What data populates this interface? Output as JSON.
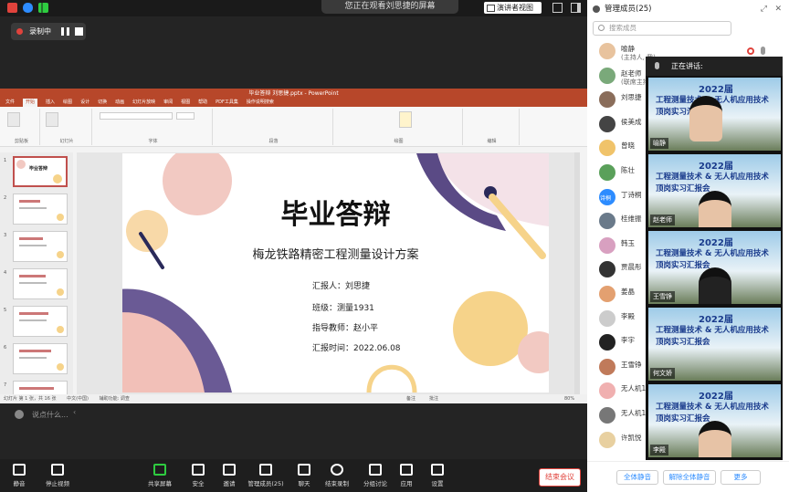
{
  "share_banner": "您正在观看刘思捷的屏幕",
  "view_menu": "演讲者视图",
  "recording": {
    "label": "录制中"
  },
  "ppt": {
    "title": "毕业答辩 刘思捷.pptx  -  PowerPoint",
    "tabs": [
      "文件",
      "开始",
      "插入",
      "绘图",
      "设计",
      "切换",
      "动画",
      "幻灯片放映",
      "审阅",
      "视图",
      "帮助",
      "PDF工具集",
      "操作说明搜索"
    ],
    "groups": [
      "剪贴板",
      "幻灯片",
      "字体",
      "段落",
      "绘图",
      "编辑"
    ],
    "status_left": "幻灯片 第 1 张，共 16 张",
    "status_lang": "中文(中国)",
    "status_access": "辅助功能: 调查",
    "status_notes": "备注",
    "status_comments": "批注",
    "status_zoom": "80%"
  },
  "slide": {
    "title": "毕业答辩",
    "subtitle": "梅龙铁路精密工程测量设计方案",
    "reporter": "汇报人：刘思捷",
    "class": "班级：测量1931",
    "teacher": "指导教师：赵小平",
    "date": "汇报时间：2022.06.08"
  },
  "thumb_numbers": [
    "1",
    "2",
    "3",
    "4",
    "5",
    "6",
    "7"
  ],
  "thumb_title": "毕业答辩",
  "chat_placeholder": "说点什么...",
  "toolbar": [
    {
      "label": "静音",
      "icon": "mic-icon"
    },
    {
      "label": "停止视频",
      "icon": "video-icon"
    },
    {
      "label": "共享屏幕",
      "icon": "share-screen-icon"
    },
    {
      "label": "安全",
      "icon": "shield-icon"
    },
    {
      "label": "邀请",
      "icon": "invite-icon"
    },
    {
      "label": "管理成员(25)",
      "icon": "participants-icon"
    },
    {
      "label": "聊天",
      "icon": "chat-icon"
    },
    {
      "label": "结束录制",
      "icon": "record-icon"
    },
    {
      "label": "分组讨论",
      "icon": "breakout-icon"
    },
    {
      "label": "应用",
      "icon": "apps-icon"
    },
    {
      "label": "设置",
      "icon": "gear-icon"
    }
  ],
  "end_meeting": "结束会议",
  "panel": {
    "title": "管理成员(25)",
    "search_placeholder": "搜索成员",
    "speaking": "正在讲话:",
    "members": [
      {
        "name": "喻静",
        "sub": "(主持人, 我)",
        "color": "#e8c39e"
      },
      {
        "name": "赵老师",
        "sub": "(联席主持人)",
        "color": "#7aa97a"
      },
      {
        "name": "刘思捷",
        "sub": "",
        "color": "#8a6d5a"
      },
      {
        "name": "侯美成",
        "sub": "",
        "color": "#444444"
      },
      {
        "name": "曾晓",
        "sub": "",
        "color": "#f0c36a"
      },
      {
        "name": "陈壮",
        "sub": "",
        "color": "#5aa05a"
      },
      {
        "name": "丁诗桐",
        "sub": "",
        "color": "#2d8cff"
      },
      {
        "name": "桂维振",
        "sub": "",
        "color": "#6a7a8a"
      },
      {
        "name": "韩玉",
        "sub": "",
        "color": "#d8a0c0"
      },
      {
        "name": "贾晨彤",
        "sub": "",
        "color": "#333333"
      },
      {
        "name": "姜晶",
        "sub": "",
        "color": "#e3a070"
      },
      {
        "name": "李殿",
        "sub": "",
        "color": "#cccccc"
      },
      {
        "name": "李宇",
        "sub": "",
        "color": "#222222"
      },
      {
        "name": "王雪铮",
        "sub": "",
        "color": "#c07a5a"
      },
      {
        "name": "无人机1组",
        "sub": "",
        "color": "#f0b0b0"
      },
      {
        "name": "无人机1组",
        "sub": "",
        "color": "#777777"
      },
      {
        "name": "许凯悦",
        "sub": "",
        "color": "#e8d0a0"
      }
    ],
    "avatar_text_dingshitong": "诗桐",
    "btn_mute_all": "全体静音",
    "btn_unmute_all": "解除全体静音",
    "btn_more": "更多"
  },
  "videos": [
    {
      "name": "喻静",
      "title": "2022届"
    },
    {
      "name": "赵老师",
      "title": "2022届"
    },
    {
      "name": "王雪铮",
      "title": "2022届"
    },
    {
      "name": "何文娇",
      "title": "2022届"
    },
    {
      "name": "李殿",
      "title": "2022届"
    }
  ],
  "video_banner_lines": [
    "工程测量技术 & 无人机应用技术",
    "顶岗实习汇报会"
  ]
}
